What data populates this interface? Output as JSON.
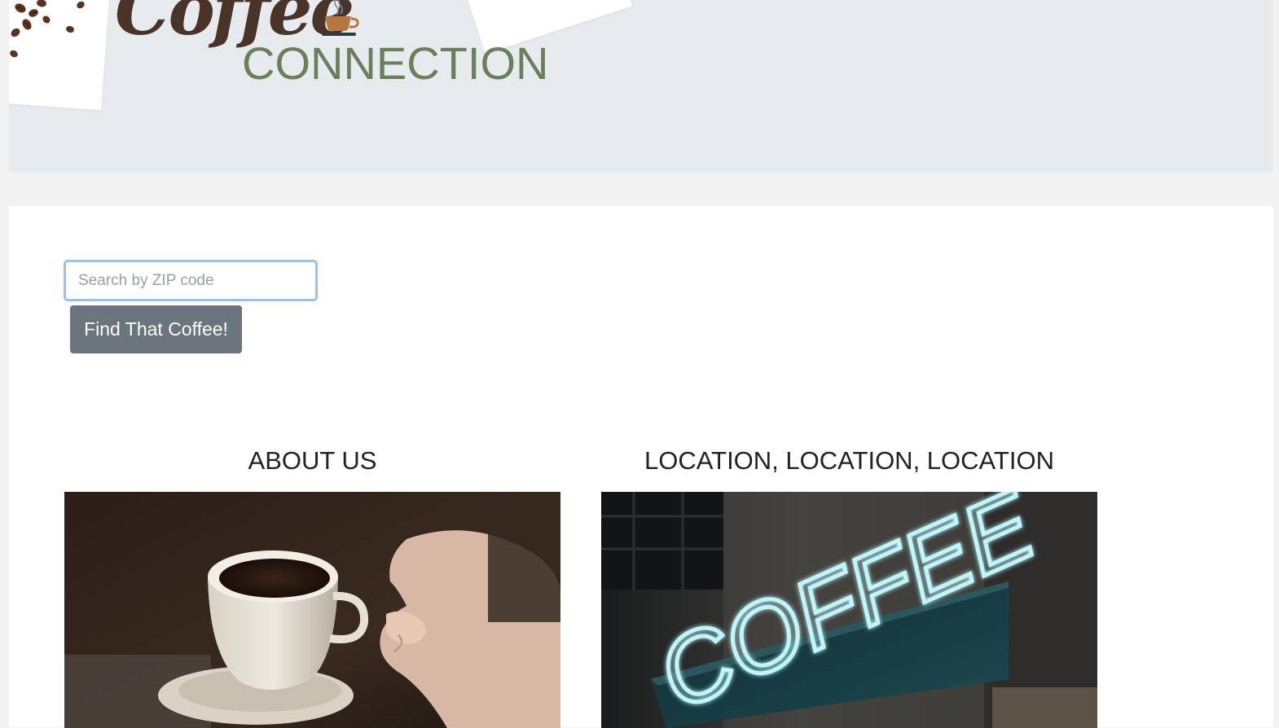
{
  "header": {
    "logo": {
      "script_word": "Coffee",
      "word": "CONNECTION"
    }
  },
  "search": {
    "placeholder": "Search by ZIP code",
    "value": "",
    "button_label": "Find That Coffee!"
  },
  "sections": [
    {
      "title": "ABOUT US",
      "image": "coffee-cup-photo"
    },
    {
      "title": "LOCATION, LOCATION, LOCATION",
      "image": "neon-coffee-sign-photo",
      "sign_text": "COFFEE"
    }
  ],
  "colors": {
    "banner_bg": "#e8ebee",
    "logo_brown": "#4a3328",
    "logo_green": "#6b7f5c",
    "button_bg": "#6c757d",
    "input_focus": "#9cc2ec",
    "neon": "#7ee8f2"
  }
}
